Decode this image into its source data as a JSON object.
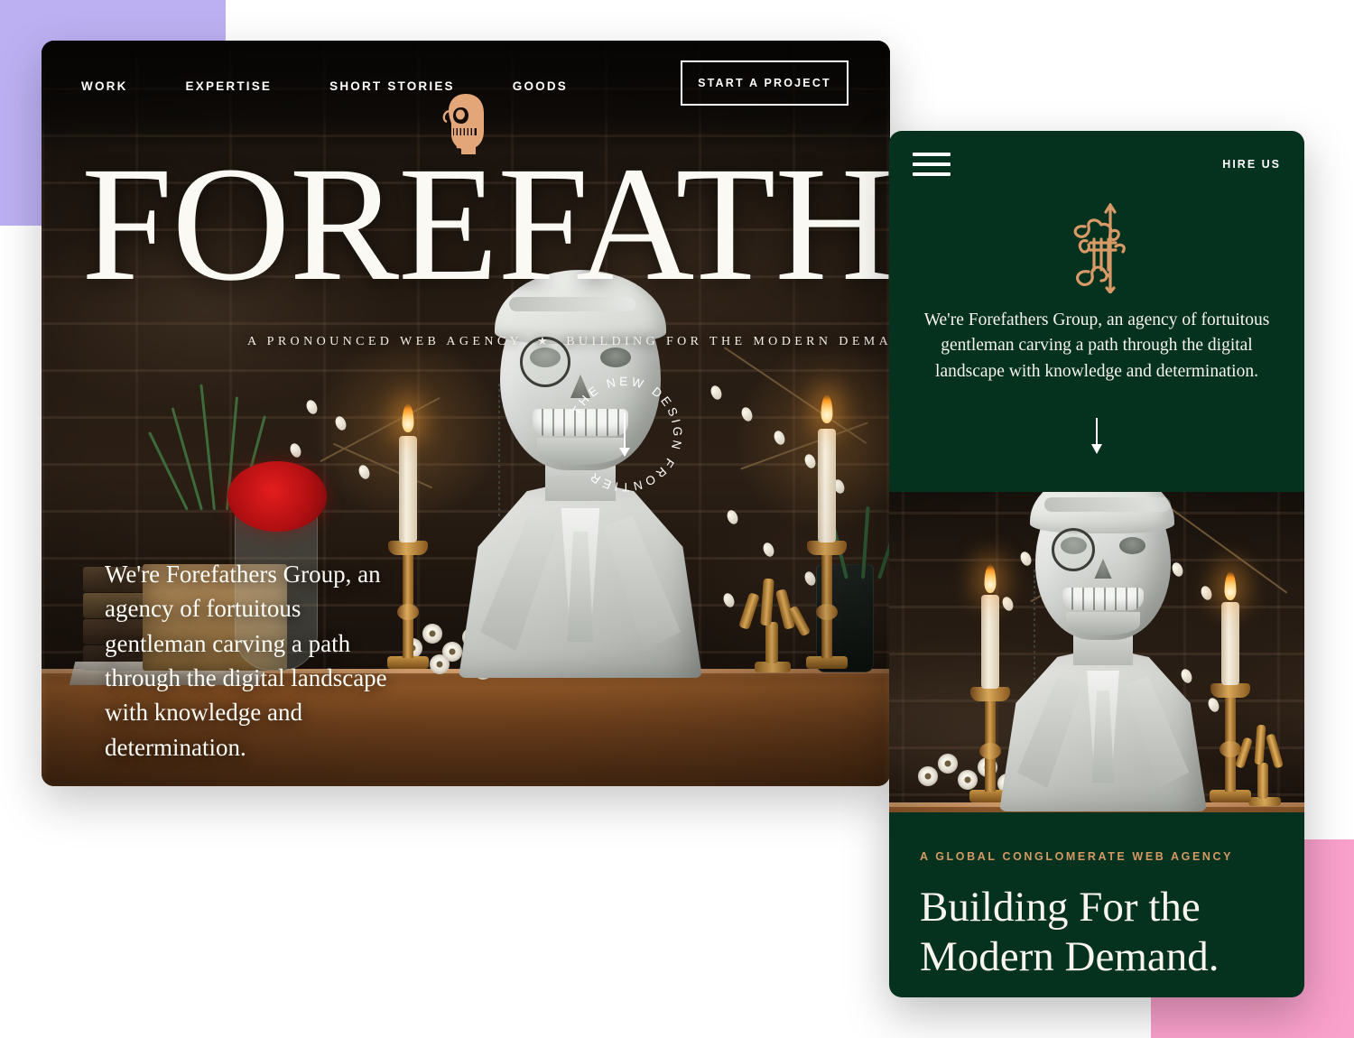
{
  "theme": {
    "dark_green": "#05311f",
    "tan": "#d49a63",
    "cream": "#fbf9f4",
    "lavender_square": "#bcb0f2",
    "pink_square": "#f9a0cb"
  },
  "desktop": {
    "nav": {
      "items": [
        {
          "label": "WORK"
        },
        {
          "label": "EXPERTISE"
        },
        {
          "label": "SHORT STORIES"
        },
        {
          "label": "GOODS"
        }
      ],
      "logo_icon": "skull-bust-logo-icon",
      "cta_label": "START A PROJECT"
    },
    "headline": "FOREFATHE",
    "tagline_left": "A PRONOUNCED WEB AGENCY",
    "tagline_star": "★",
    "tagline_right": "BUILDING FOR THE MODERN DEMAND",
    "body_copy": "We're Forefathers Group, an agency of fortuitous gentleman carving a path through the digital landscape with knowledge and determination.",
    "seal": {
      "text": "THE NEW DESIGN FRONTIER ",
      "arrow_icon": "arrow-down-icon"
    }
  },
  "mobile": {
    "menu_icon": "hamburger-menu-icon",
    "hire_label": "HIRE US",
    "monogram_icon": "blackletter-f-monogram-icon",
    "body_copy": "We're Forefathers Group, an agency of fortuitous gentleman carving a path through the digital landscape with knowledge and determination.",
    "scroll_icon": "arrow-down-icon",
    "eyebrow": "A GLOBAL CONGLOMERATE WEB AGENCY",
    "title": "Building For the Modern Demand."
  }
}
